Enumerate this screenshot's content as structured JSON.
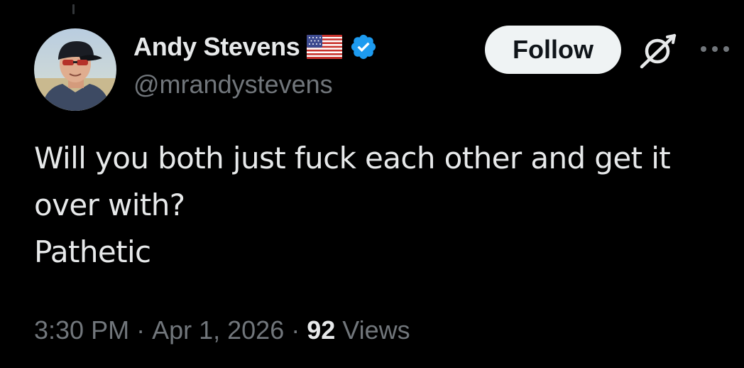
{
  "author": {
    "display_name": "Andy Stevens",
    "handle": "@mrandystevens",
    "verified": true,
    "flag": "us-flag-icon",
    "verified_badge_color": "#1d9bf0"
  },
  "actions": {
    "follow_label": "Follow",
    "grok_icon": "grok-icon",
    "more_icon": "more-icon"
  },
  "tweet": {
    "lines": [
      "Will you both just fuck each other and get it",
      "over with?",
      "Pathetic"
    ]
  },
  "meta": {
    "time": "3:30 PM",
    "separator": "·",
    "date": "Apr 1, 2026",
    "views_count": "92",
    "views_label": "Views"
  },
  "colors": {
    "background": "#000000",
    "primary_text": "#e7e9ea",
    "secondary_text": "#71767b",
    "follow_button_bg": "#eff3f4",
    "follow_button_text": "#0f1419"
  }
}
